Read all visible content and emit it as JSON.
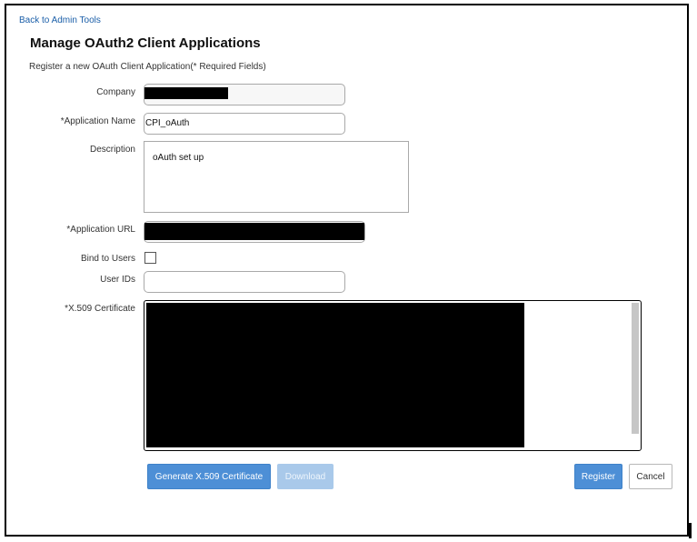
{
  "nav": {
    "back_label": "Back to Admin Tools"
  },
  "page": {
    "title": "Manage OAuth2 Client Applications",
    "subtitle": "Register a new OAuth Client Application(* Required Fields)"
  },
  "form": {
    "company": {
      "label": "Company",
      "value": ""
    },
    "app_name": {
      "label": "*Application Name",
      "value": "CPI_oAuth"
    },
    "description": {
      "label": "Description",
      "value": "oAuth set up"
    },
    "app_url": {
      "label": "*Application URL",
      "value": ""
    },
    "bind_users": {
      "label": "Bind to Users",
      "checked": false
    },
    "user_ids": {
      "label": "User IDs",
      "value": ""
    },
    "certificate": {
      "label": "*X.509 Certificate"
    }
  },
  "buttons": {
    "generate": "Generate X.509 Certificate",
    "download": "Download",
    "register": "Register",
    "cancel": "Cancel"
  },
  "colors": {
    "primary": "#4d8fd6",
    "primary_disabled": "#a9c9ea",
    "link": "#1a5ea8"
  }
}
